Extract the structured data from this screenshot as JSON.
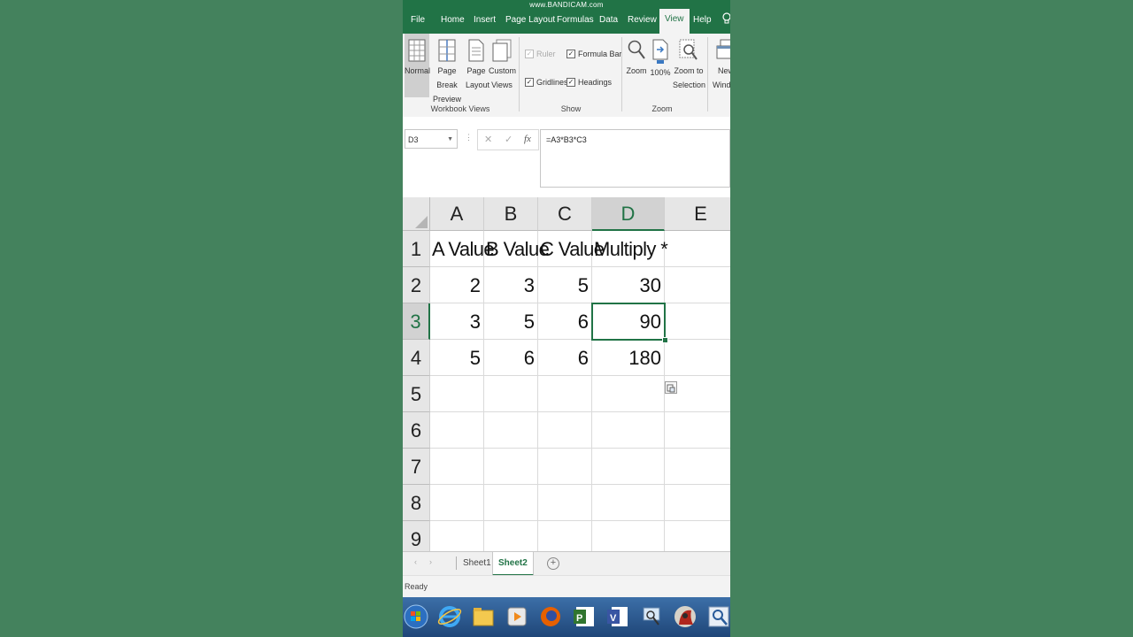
{
  "watermark": "www.BANDICAM.com",
  "ribbon_tabs": [
    {
      "label": "File"
    },
    {
      "label": "Home"
    },
    {
      "label": "Insert"
    },
    {
      "label": "Page Layout"
    },
    {
      "label": "Formulas"
    },
    {
      "label": "Data"
    },
    {
      "label": "Review"
    },
    {
      "label": "View",
      "active": true
    },
    {
      "label": "Help"
    }
  ],
  "ribbon": {
    "workbook_views": {
      "normal": "Normal",
      "page_break_1": "Page Break",
      "page_break_2": "Preview",
      "page_layout_1": "Page",
      "page_layout_2": "Layout",
      "custom_views_1": "Custom",
      "custom_views_2": "Views",
      "group_label": "Workbook Views"
    },
    "show": {
      "ruler": "Ruler",
      "formula_bar": "Formula Bar",
      "gridlines": "Gridlines",
      "headings": "Headings",
      "group_label": "Show"
    },
    "zoom": {
      "zoom": "Zoom",
      "hundred": "100%",
      "zoom_sel_1": "Zoom to",
      "zoom_sel_2": "Selection",
      "group_label": "Zoom"
    },
    "window": {
      "new_window_1": "New",
      "new_window_2": "Windo"
    }
  },
  "formula_bar": {
    "name_box": "D3",
    "cancel": "✕",
    "enter": "✓",
    "fx": "fx",
    "formula": "=A3*B3*C3"
  },
  "grid": {
    "columns": [
      "A",
      "B",
      "C",
      "D",
      "E"
    ],
    "rows": [
      "1",
      "2",
      "3",
      "4",
      "5",
      "6",
      "7",
      "8",
      "9"
    ],
    "cells": {
      "r1": [
        "A Value",
        "B Value",
        "C Value",
        "Multiply *"
      ],
      "r2": [
        "2",
        "3",
        "5",
        "30"
      ],
      "r3": [
        "3",
        "5",
        "6",
        "90"
      ],
      "r4": [
        "5",
        "6",
        "6",
        "180"
      ]
    },
    "selected_cell": "D3"
  },
  "sheets": [
    "Sheet1",
    "Sheet2"
  ],
  "active_sheet": "Sheet2",
  "add_sheet": "+",
  "status": "Ready",
  "colors": {
    "excel_green": "#217346",
    "background": "#44825d"
  }
}
